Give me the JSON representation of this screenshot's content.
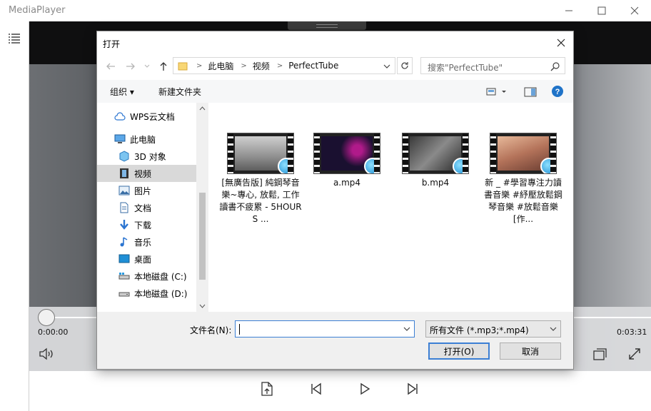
{
  "app": {
    "title": "MediaPlayer",
    "time_current": "0:00:00",
    "time_total": "0:03:31",
    "progress": 0
  },
  "dialog": {
    "title": "打开",
    "breadcrumb": [
      "此电脑",
      "视频",
      "PerfectTube"
    ],
    "search_placeholder": "搜索\"PerfectTube\"",
    "toolbar": {
      "organize": "组织",
      "new_folder": "新建文件夹"
    },
    "nav": [
      {
        "label": "WPS云文档",
        "icon": "cloud-icon"
      },
      {
        "label": "此电脑",
        "icon": "computer-icon"
      },
      {
        "label": "3D 对象",
        "icon": "cube-icon"
      },
      {
        "label": "视频",
        "icon": "film-icon",
        "selected": true
      },
      {
        "label": "图片",
        "icon": "picture-icon"
      },
      {
        "label": "文档",
        "icon": "document-icon"
      },
      {
        "label": "下载",
        "icon": "download-icon"
      },
      {
        "label": "音乐",
        "icon": "music-icon"
      },
      {
        "label": "桌面",
        "icon": "desktop-icon"
      },
      {
        "label": "本地磁盘 (C:)",
        "icon": "drive-icon"
      },
      {
        "label": "本地磁盘 (D:)",
        "icon": "drive-icon"
      }
    ],
    "files": [
      {
        "name": "[無廣告版] 純鋼琴音樂~專心, 放鬆, 工作讀書不疲累 - 5HOURS ..."
      },
      {
        "name": "a.mp4"
      },
      {
        "name": "b.mp4"
      },
      {
        "name": "新 _ #學習專注力讀書音樂 #紓壓放鬆鋼琴音樂 #放鬆音樂 [作..."
      }
    ],
    "filename_label": "文件名(N):",
    "filename_value": "",
    "filetype": "所有文件 (*.mp3;*.mp4)",
    "open_button": "打开(O)",
    "cancel_button": "取消"
  }
}
